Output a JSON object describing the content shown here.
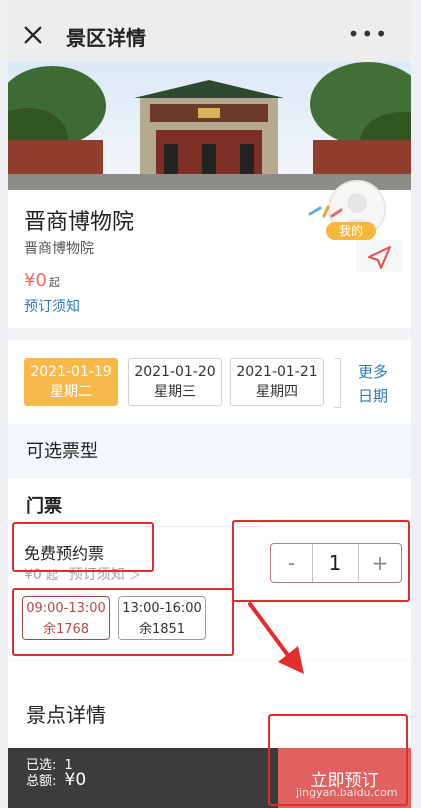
{
  "header": {
    "title": "景区详情",
    "more": "•••"
  },
  "poi": {
    "name": "晋商博物院",
    "subtitle": "晋商博物院",
    "price": "¥0",
    "price_suffix": "起",
    "notice": "预订须知",
    "badge": "我的"
  },
  "dates": [
    {
      "date": "2021-01-19",
      "weekday": "星期二",
      "selected": true
    },
    {
      "date": "2021-01-20",
      "weekday": "星期三",
      "selected": false
    },
    {
      "date": "2021-01-21",
      "weekday": "星期四",
      "selected": false
    }
  ],
  "more_dates": {
    "line1": "更多",
    "line2": "日期"
  },
  "ticket_section": "可选票型",
  "ticket_group": "门票",
  "ticket": {
    "name": "免费预约票",
    "price": "¥0",
    "from": "起",
    "notice": "预订须知",
    "arrow": "＞"
  },
  "stepper": {
    "minus": "-",
    "value": "1",
    "plus": "+"
  },
  "slots": [
    {
      "time": "09:00-13:00",
      "remain": "余1768"
    },
    {
      "time": "13:00-16:00",
      "remain": "余1851"
    }
  ],
  "detail_section": "景点详情",
  "bottom": {
    "selected": "已选:",
    "selected_count": "1",
    "total": "总额:",
    "total_value": "¥0",
    "cta": "立即预订"
  },
  "watermark": "jingyan.baidu.com",
  "colors": {
    "accent": "#F8B94B",
    "link": "#2F7AB8",
    "price": "#F46B63",
    "cta": "#E16060",
    "annotation": "#E52C2C"
  }
}
